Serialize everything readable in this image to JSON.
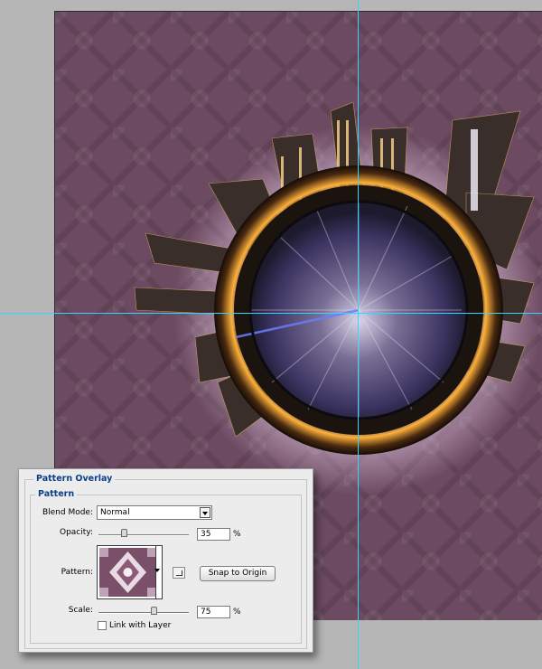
{
  "dialog": {
    "section_title": "Pattern Overlay",
    "group_title": "Pattern",
    "blend_mode": {
      "label": "Blend Mode:",
      "value": "Normal"
    },
    "opacity": {
      "label": "Opacity:",
      "value": "35",
      "unit": "%",
      "level": 0.35
    },
    "pattern": {
      "label": "Pattern:",
      "snap_button": "Snap to Origin"
    },
    "scale": {
      "label": "Scale:",
      "value": "75",
      "unit": "%",
      "level": 0.75
    },
    "link_with_layer": {
      "label": "Link with Layer",
      "checked": false
    }
  },
  "colors": {
    "canvas_bg": "#6c4a61",
    "guide": "#33d6ff",
    "accent_title": "#0a3f8a"
  },
  "icons": {
    "pattern_dropdown": "chevron-down-icon",
    "new_preset": "new-preset-icon"
  }
}
